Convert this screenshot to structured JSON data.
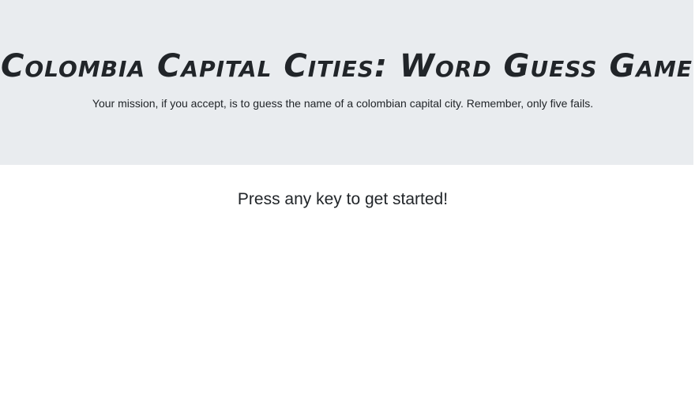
{
  "header": {
    "title": "Colombia Capital Cities: Word Guess Game",
    "subtitle": "Your mission, if you accept, is to guess the name of a colombian capital city. Remember, only five fails."
  },
  "main": {
    "start_prompt": "Press any key to get started!"
  },
  "colors": {
    "header_background": "#e9ecef",
    "page_background": "#ffffff",
    "text": "#212529"
  }
}
